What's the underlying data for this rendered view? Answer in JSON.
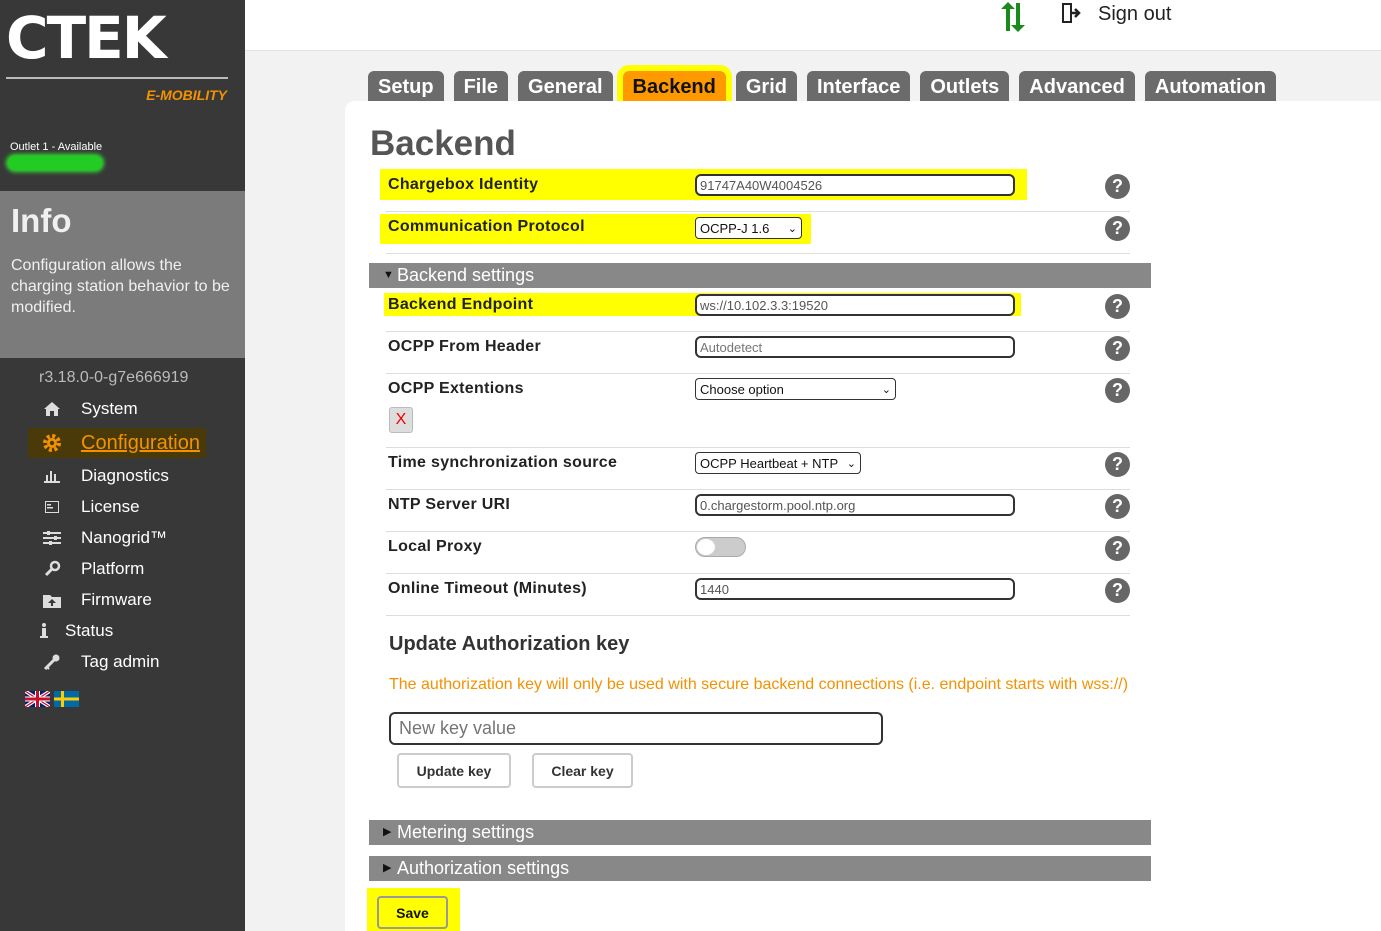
{
  "brand": {
    "logo": "CTEK",
    "sub": "E-MOBILITY"
  },
  "outlet": {
    "label": "Outlet 1 - Available"
  },
  "info": {
    "title": "Info",
    "text": "Configuration allows the charging station behavior to be modified."
  },
  "version": "r3.18.0-0-g7e666919",
  "nav": [
    {
      "label": "System",
      "icon": "home-icon"
    },
    {
      "label": "Configuration",
      "icon": "gear-icon"
    },
    {
      "label": "Diagnostics",
      "icon": "bar-chart-icon"
    },
    {
      "label": "License",
      "icon": "license-icon"
    },
    {
      "label": "Nanogrid™",
      "icon": "sliders-icon"
    },
    {
      "label": "Platform",
      "icon": "wrench-icon"
    },
    {
      "label": "Firmware",
      "icon": "upload-folder-icon"
    },
    {
      "label": "Status",
      "icon": "info-icon"
    },
    {
      "label": "Tag admin",
      "icon": "key-icon"
    }
  ],
  "topbar": {
    "signout": "Sign out"
  },
  "tabs": [
    "Setup",
    "File",
    "General",
    "Backend",
    "Grid",
    "Interface",
    "Outlets",
    "Advanced",
    "Automation"
  ],
  "page": {
    "title": "Backend"
  },
  "fields": {
    "chargebox_identity": {
      "label": "Chargebox Identity",
      "value": "91747A40W4004526"
    },
    "protocol": {
      "label": "Communication Protocol",
      "value": "OCPP-J 1.6"
    },
    "backend_endpoint": {
      "label": "Backend Endpoint",
      "value": "ws://10.102.3.3:19520"
    },
    "ocpp_from_header": {
      "label": "OCPP From Header",
      "placeholder": "Autodetect"
    },
    "ocpp_extentions": {
      "label": "OCPP Extentions",
      "value": "Choose option",
      "remove": "X"
    },
    "time_sync": {
      "label": "Time synchronization source",
      "value": "OCPP Heartbeat + NTP"
    },
    "ntp_server": {
      "label": "NTP Server URI",
      "value": "0.chargestorm.pool.ntp.org"
    },
    "local_proxy": {
      "label": "Local Proxy",
      "enabled": false
    },
    "online_timeout": {
      "label": "Online Timeout (Minutes)",
      "value": "1440"
    }
  },
  "help": "?",
  "sections": {
    "backend": "Backend settings",
    "metering": "Metering settings",
    "authorization": "Authorization settings"
  },
  "auth_key": {
    "title": "Update Authorization key",
    "note": "The authorization key will only be used with secure backend connections (i.e. endpoint starts with wss://)",
    "placeholder": "New key value",
    "update": "Update key",
    "clear": "Clear key"
  },
  "save": "Save",
  "colors": {
    "accent": "#f39200",
    "highlight": "#ffff00",
    "tab": "#6b6b6b",
    "active_tab": "#ff9900",
    "sidebar": "#383838"
  }
}
